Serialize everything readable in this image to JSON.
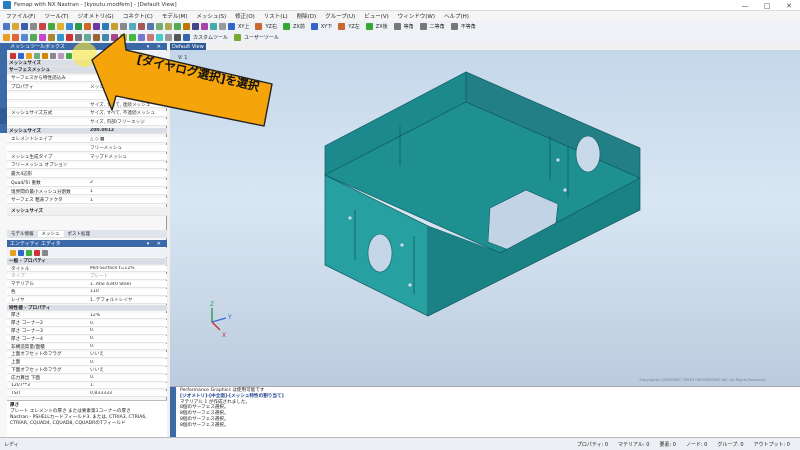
{
  "window": {
    "title": "Femap with NX Nastran - [kyoutu.modfem] - [Default View]",
    "controls": [
      "—",
      "□",
      "✕"
    ]
  },
  "menu": [
    "ファイル(F)",
    "ツール(T)",
    "ジオメトリ(G)",
    "コネクト(C)",
    "モデル(M)",
    "メッシュ(S)",
    "修正(O)",
    "リスト(L)",
    "削除(D)",
    "グループ(U)",
    "ビュー(V)",
    "ウィンドウ(W)",
    "ヘルプ(H)"
  ],
  "toolbar2": {
    "custom_tools": "カスタムツール",
    "user_tools": "ユーザーツール"
  },
  "toolbar1_labels": [
    "XY上",
    "YZ右",
    "ZX前",
    "XY下",
    "YZ左",
    "ZX後",
    "等角",
    "二等角",
    "不等角"
  ],
  "mesh_toolbox": {
    "title": "メッシュツールボックス",
    "mesh_size_header": "メッシュサイズ",
    "rows": [
      {
        "k": "サーフェスメッシュ",
        "v": "",
        "type": "sec"
      },
      {
        "k": "サーフェスから特性読込み",
        "v": "",
        "type": ""
      },
      {
        "k": "プロパティ",
        "v": "メッシュ特性を使用",
        "type": ""
      },
      {
        "k": "",
        "v": "",
        "type": ""
      },
      {
        "k": "",
        "v": "サイズ, すべて, 連続メッシュ",
        "type": ""
      },
      {
        "k": "メッシュサイズ方式",
        "v": "サイズ, すべて, 不連続メッシュ",
        "type": ""
      },
      {
        "k": "",
        "v": "サイズ, 内部/フリーエッジ",
        "type": ""
      },
      {
        "k": "メッシュサイズ",
        "v": "200.0012",
        "type": "sec"
      },
      {
        "k": "エレメントシェイプ",
        "v": "△ ◇ ▦",
        "type": ""
      },
      {
        "k": "",
        "v": "フリーメッシュ",
        "type": ""
      },
      {
        "k": "メッシュ生成タイプ",
        "v": "マップドメッシュ",
        "type": ""
      },
      {
        "k": "フリーメッシュ オプション",
        "v": "",
        "type": ""
      },
      {
        "k": "最大4辺形",
        "v": "",
        "type": ""
      },
      {
        "k": "Quad/Tri 重数",
        "v": "2",
        "type": ""
      },
      {
        "k": "境界間の最小メッシュ分割数",
        "v": "1",
        "type": ""
      },
      {
        "k": "サーフェス 粗表ファクタ",
        "v": "1",
        "type": ""
      }
    ],
    "footer_label": "メッシュサイズ",
    "tabs": [
      "モデル情報",
      "メッシュ",
      "ポスト処理"
    ]
  },
  "entity_editor": {
    "title": "エンティティ エディタ",
    "rows": [
      {
        "k": "一般 - プロパティ",
        "v": "",
        "type": "sec"
      },
      {
        "k": "タイトル",
        "v": "Mid-Surface t=12%",
        "type": ""
      },
      {
        "k": "タイプ",
        "v": "プレート",
        "type": "gray"
      },
      {
        "k": "マテリアル",
        "v": "1..AISI 4340 Steel",
        "type": ""
      },
      {
        "k": "色",
        "v": "110",
        "type": ""
      },
      {
        "k": "レイヤ",
        "v": "1..デフォルトレイヤ",
        "type": ""
      },
      {
        "k": "特性値 - プロパティ",
        "v": "",
        "type": "sec"
      },
      {
        "k": "厚さ",
        "v": "12%",
        "type": ""
      },
      {
        "k": "厚さ コーナー2",
        "v": "0.",
        "type": ""
      },
      {
        "k": "厚さ コーナー3",
        "v": "0.",
        "type": ""
      },
      {
        "k": "厚さ コーナー4",
        "v": "0.",
        "type": ""
      },
      {
        "k": "非構造質量/面積",
        "v": "0.",
        "type": ""
      },
      {
        "k": "上面オフセットのフラグ",
        "v": "いいえ",
        "type": ""
      },
      {
        "k": "上面",
        "v": "0.",
        "type": ""
      },
      {
        "k": "下面オフセットのフラグ",
        "v": "いいえ",
        "type": ""
      },
      {
        "k": "応力算出 下面",
        "v": "0.",
        "type": ""
      },
      {
        "k": "12I/T**3",
        "v": "1.",
        "type": ""
      },
      {
        "k": "TS/T",
        "v": "0.833333",
        "type": ""
      }
    ],
    "desc_title": "厚さ",
    "desc_text1": "プレート エレメントの厚さ または要素第1コーナーの厚さ",
    "desc_text2": "Nastran - PSHELLカードフィールド3. または, CTRIA3, CTRIA6, CTRIAR, CQUAD4, CQUAD8, CQUADRのTフィールド"
  },
  "view": {
    "tab_label": "Default View",
    "label": "V: 1",
    "copyright": "Copyright(c) NCEEMEIC FREES ENGINEERING INC. All Rights Reserved.",
    "body_color": "#1f8f91",
    "edge_color": "#0d5c60"
  },
  "messages": [
    {
      "text": "Performance Graphics は使用可能です",
      "hl": false
    },
    {
      "text": "[ジオメトリ]-[中立面]-[メッシュ特性の割り当て]",
      "hl": true
    },
    {
      "text": "マテリアル 1 が作成されました。",
      "hl": false
    },
    {
      "text": "8個のサーフェス選択。",
      "hl": false
    },
    {
      "text": "8個のサーフェス選択。",
      "hl": false
    },
    {
      "text": "8個のサーフェス選択。",
      "hl": false
    },
    {
      "text": "8個のサーフェス選択。",
      "hl": false
    }
  ],
  "statusbar": {
    "left": "レディ",
    "items": [
      "プロパティ: 0",
      "マテリアル: 0",
      "要素: 0",
      "ノード: 0",
      "グループ: 0",
      "アウトプット: 0"
    ]
  },
  "annotation": {
    "text": "[ダイヤログ選択]を選択",
    "colors": {
      "fill": "#f5a50a",
      "border": "#222222"
    }
  }
}
